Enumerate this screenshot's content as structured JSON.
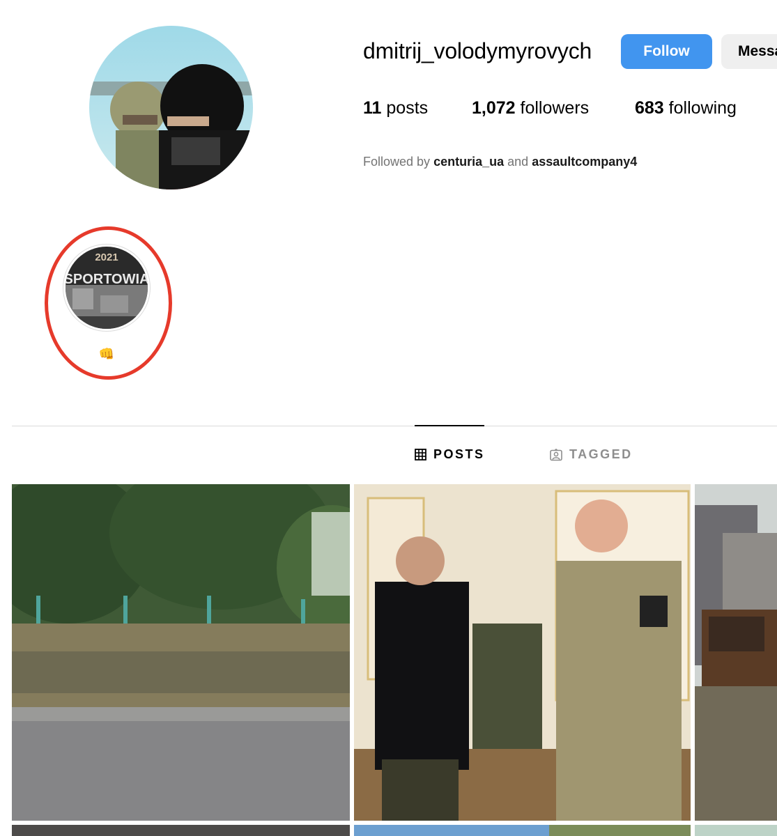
{
  "profile": {
    "username": "dmitrij_volodymyrovych",
    "follow_label": "Follow",
    "message_label": "Message",
    "stats": {
      "posts_count": "11",
      "posts_label": "posts",
      "followers_count": "1,072",
      "followers_label": "followers",
      "following_count": "683",
      "following_label": "following"
    },
    "followed_by": {
      "prefix": "Followed by",
      "account_1": "centuria_ua",
      "joiner": "and",
      "account_2": "assaultcompany4"
    }
  },
  "highlight": {
    "label": "👊",
    "cover_text_year": "2021",
    "cover_text_word": "SPORTOWIA"
  },
  "tabs": {
    "posts": "POSTS",
    "tagged": "TAGGED"
  },
  "colors": {
    "follow_button": "#4195ef",
    "message_button": "#efefef",
    "annotation_oval": "#e63a2b",
    "muted_text": "#737373"
  },
  "icons": {
    "posts_tab": "grid-icon",
    "tagged_tab": "tagged-user-icon"
  }
}
